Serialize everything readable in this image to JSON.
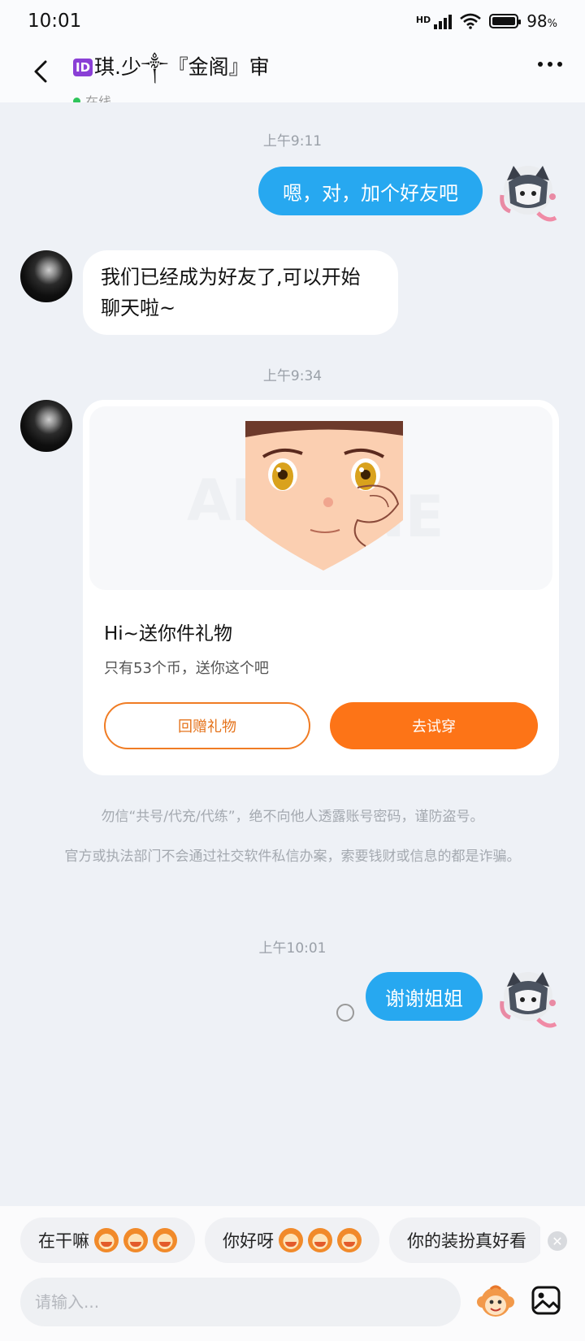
{
  "status_bar": {
    "time": "10:01",
    "network": "HD",
    "battery": "98",
    "battery_percent_sign": "%",
    "battery_level": 0.98
  },
  "header": {
    "badge": "ID",
    "title": "琪.少༒『金阁』审",
    "status": "在线"
  },
  "messages": [
    {
      "timestamp": "上午9:11",
      "side": "right",
      "text": "嗯，对，加个好友吧"
    },
    {
      "side": "left",
      "text_line1": "我们已经成为好友了,可以开始",
      "text_line2": "聊天啦~"
    },
    {
      "timestamp": "上午9:34"
    },
    {
      "timestamp": "上午10:01",
      "side": "right",
      "text": "谢谢姐姐"
    }
  ],
  "gift_card": {
    "title": "Hi~送你件礼物",
    "subtitle": "只有53个币，送你这个吧",
    "return_gift_label": "回赠礼物",
    "try_on_label": "去试穿"
  },
  "notices": {
    "line1": "勿信“共号/代充/代练”，绝不向他人透露账号密码，谨防盗号。",
    "line2": "官方或执法部门不会通过社交软件私信办案，索要钱财或信息的都是诈骗。"
  },
  "quick_replies": [
    "在干嘛",
    "你好呀",
    "你的装扮真好看"
  ],
  "input": {
    "placeholder": "请输入...",
    "value": ""
  },
  "colors": {
    "accent_blue": "#27a8f0",
    "accent_orange": "#fd7417",
    "online_green": "#2ec45a"
  }
}
